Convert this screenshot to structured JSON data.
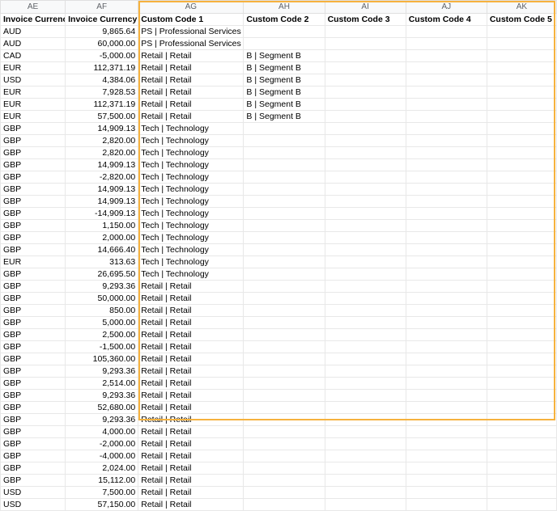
{
  "columns": [
    {
      "letter": "AE",
      "header": "Invoice Currency"
    },
    {
      "letter": "AF",
      "header": "Invoice Currency"
    },
    {
      "letter": "AG",
      "header": "Custom Code 1"
    },
    {
      "letter": "AH",
      "header": "Custom Code 2"
    },
    {
      "letter": "AI",
      "header": "Custom Code 3"
    },
    {
      "letter": "AJ",
      "header": "Custom Code 4"
    },
    {
      "letter": "AK",
      "header": "Custom Code 5"
    }
  ],
  "rows": [
    {
      "cur": "AUD",
      "amt": "9,865.64",
      "c1": "PS | Professional Services",
      "c2": ""
    },
    {
      "cur": "AUD",
      "amt": "60,000.00",
      "c1": "PS | Professional Services",
      "c2": ""
    },
    {
      "cur": "CAD",
      "amt": "-5,000.00",
      "c1": "Retail | Retail",
      "c2": "B | Segment B"
    },
    {
      "cur": "EUR",
      "amt": "112,371.19",
      "c1": "Retail | Retail",
      "c2": "B | Segment B"
    },
    {
      "cur": "USD",
      "amt": "4,384.06",
      "c1": "Retail | Retail",
      "c2": "B | Segment B"
    },
    {
      "cur": "EUR",
      "amt": "7,928.53",
      "c1": "Retail | Retail",
      "c2": "B | Segment B"
    },
    {
      "cur": "EUR",
      "amt": "112,371.19",
      "c1": "Retail | Retail",
      "c2": "B | Segment B"
    },
    {
      "cur": "EUR",
      "amt": "57,500.00",
      "c1": "Retail | Retail",
      "c2": "B | Segment B"
    },
    {
      "cur": "GBP",
      "amt": "14,909.13",
      "c1": "Tech | Technology",
      "c2": ""
    },
    {
      "cur": "GBP",
      "amt": "2,820.00",
      "c1": "Tech | Technology",
      "c2": ""
    },
    {
      "cur": "GBP",
      "amt": "2,820.00",
      "c1": "Tech | Technology",
      "c2": ""
    },
    {
      "cur": "GBP",
      "amt": "14,909.13",
      "c1": "Tech | Technology",
      "c2": ""
    },
    {
      "cur": "GBP",
      "amt": "-2,820.00",
      "c1": "Tech | Technology",
      "c2": ""
    },
    {
      "cur": "GBP",
      "amt": "14,909.13",
      "c1": "Tech | Technology",
      "c2": ""
    },
    {
      "cur": "GBP",
      "amt": "14,909.13",
      "c1": "Tech | Technology",
      "c2": ""
    },
    {
      "cur": "GBP",
      "amt": "-14,909.13",
      "c1": "Tech | Technology",
      "c2": ""
    },
    {
      "cur": "GBP",
      "amt": "1,150.00",
      "c1": "Tech | Technology",
      "c2": ""
    },
    {
      "cur": "GBP",
      "amt": "2,000.00",
      "c1": "Tech | Technology",
      "c2": ""
    },
    {
      "cur": "GBP",
      "amt": "14,666.40",
      "c1": "Tech | Technology",
      "c2": ""
    },
    {
      "cur": "EUR",
      "amt": "313.63",
      "c1": "Tech | Technology",
      "c2": ""
    },
    {
      "cur": "GBP",
      "amt": "26,695.50",
      "c1": "Tech | Technology",
      "c2": ""
    },
    {
      "cur": "GBP",
      "amt": "9,293.36",
      "c1": "Retail | Retail",
      "c2": ""
    },
    {
      "cur": "GBP",
      "amt": "50,000.00",
      "c1": "Retail | Retail",
      "c2": ""
    },
    {
      "cur": "GBP",
      "amt": "850.00",
      "c1": "Retail | Retail",
      "c2": ""
    },
    {
      "cur": "GBP",
      "amt": "5,000.00",
      "c1": "Retail | Retail",
      "c2": ""
    },
    {
      "cur": "GBP",
      "amt": "2,500.00",
      "c1": "Retail | Retail",
      "c2": ""
    },
    {
      "cur": "GBP",
      "amt": "-1,500.00",
      "c1": "Retail | Retail",
      "c2": ""
    },
    {
      "cur": "GBP",
      "amt": "105,360.00",
      "c1": "Retail | Retail",
      "c2": ""
    },
    {
      "cur": "GBP",
      "amt": "9,293.36",
      "c1": "Retail | Retail",
      "c2": ""
    },
    {
      "cur": "GBP",
      "amt": "2,514.00",
      "c1": "Retail | Retail",
      "c2": ""
    },
    {
      "cur": "GBP",
      "amt": "9,293.36",
      "c1": "Retail | Retail",
      "c2": ""
    },
    {
      "cur": "GBP",
      "amt": "52,680.00",
      "c1": "Retail | Retail",
      "c2": ""
    },
    {
      "cur": "GBP",
      "amt": "9,293.36",
      "c1": "Retail | Retail",
      "c2": ""
    },
    {
      "cur": "GBP",
      "amt": "4,000.00",
      "c1": "Retail | Retail",
      "c2": ""
    },
    {
      "cur": "GBP",
      "amt": "-2,000.00",
      "c1": "Retail | Retail",
      "c2": ""
    },
    {
      "cur": "GBP",
      "amt": "-4,000.00",
      "c1": "Retail | Retail",
      "c2": ""
    },
    {
      "cur": "GBP",
      "amt": "2,024.00",
      "c1": "Retail | Retail",
      "c2": ""
    },
    {
      "cur": "GBP",
      "amt": "15,112.00",
      "c1": "Retail | Retail",
      "c2": ""
    },
    {
      "cur": "USD",
      "amt": "7,500.00",
      "c1": "Retail | Retail",
      "c2": ""
    },
    {
      "cur": "USD",
      "amt": "57,150.00",
      "c1": "Retail | Retail",
      "c2": ""
    }
  ]
}
